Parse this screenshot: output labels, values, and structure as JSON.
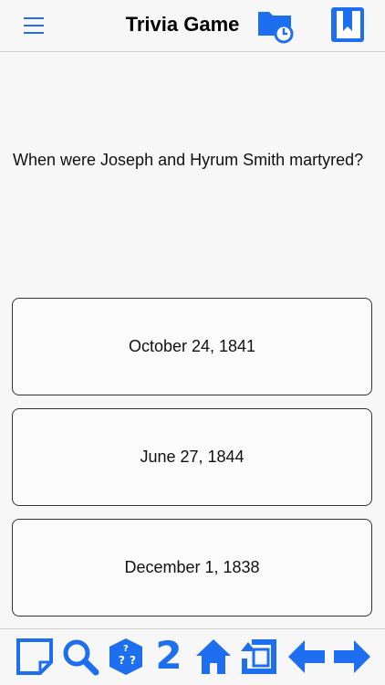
{
  "header": {
    "title": "Trivia Game",
    "menu_icon": "hamburger-menu-icon",
    "folder_icon": "folder-clock-icon",
    "bookmark_icon": "bookmark-book-icon"
  },
  "question": {
    "text": "When were Joseph and Hyrum Smith martyred?"
  },
  "answers": [
    {
      "label": "October 24, 1841"
    },
    {
      "label": "June 27, 1844"
    },
    {
      "label": "December 1, 1838"
    }
  ],
  "toolbar": {
    "items": [
      {
        "icon": "note-icon"
      },
      {
        "icon": "search-icon"
      },
      {
        "icon": "dice-icon"
      },
      {
        "icon": "number-icon",
        "label": "2"
      },
      {
        "icon": "home-icon"
      },
      {
        "icon": "rotate-icon"
      },
      {
        "icon": "arrow-left-icon"
      },
      {
        "icon": "arrow-right-icon"
      }
    ]
  },
  "colors": {
    "accent": "#1e6ff0",
    "background": "#f7f7f7",
    "border": "#333333"
  }
}
